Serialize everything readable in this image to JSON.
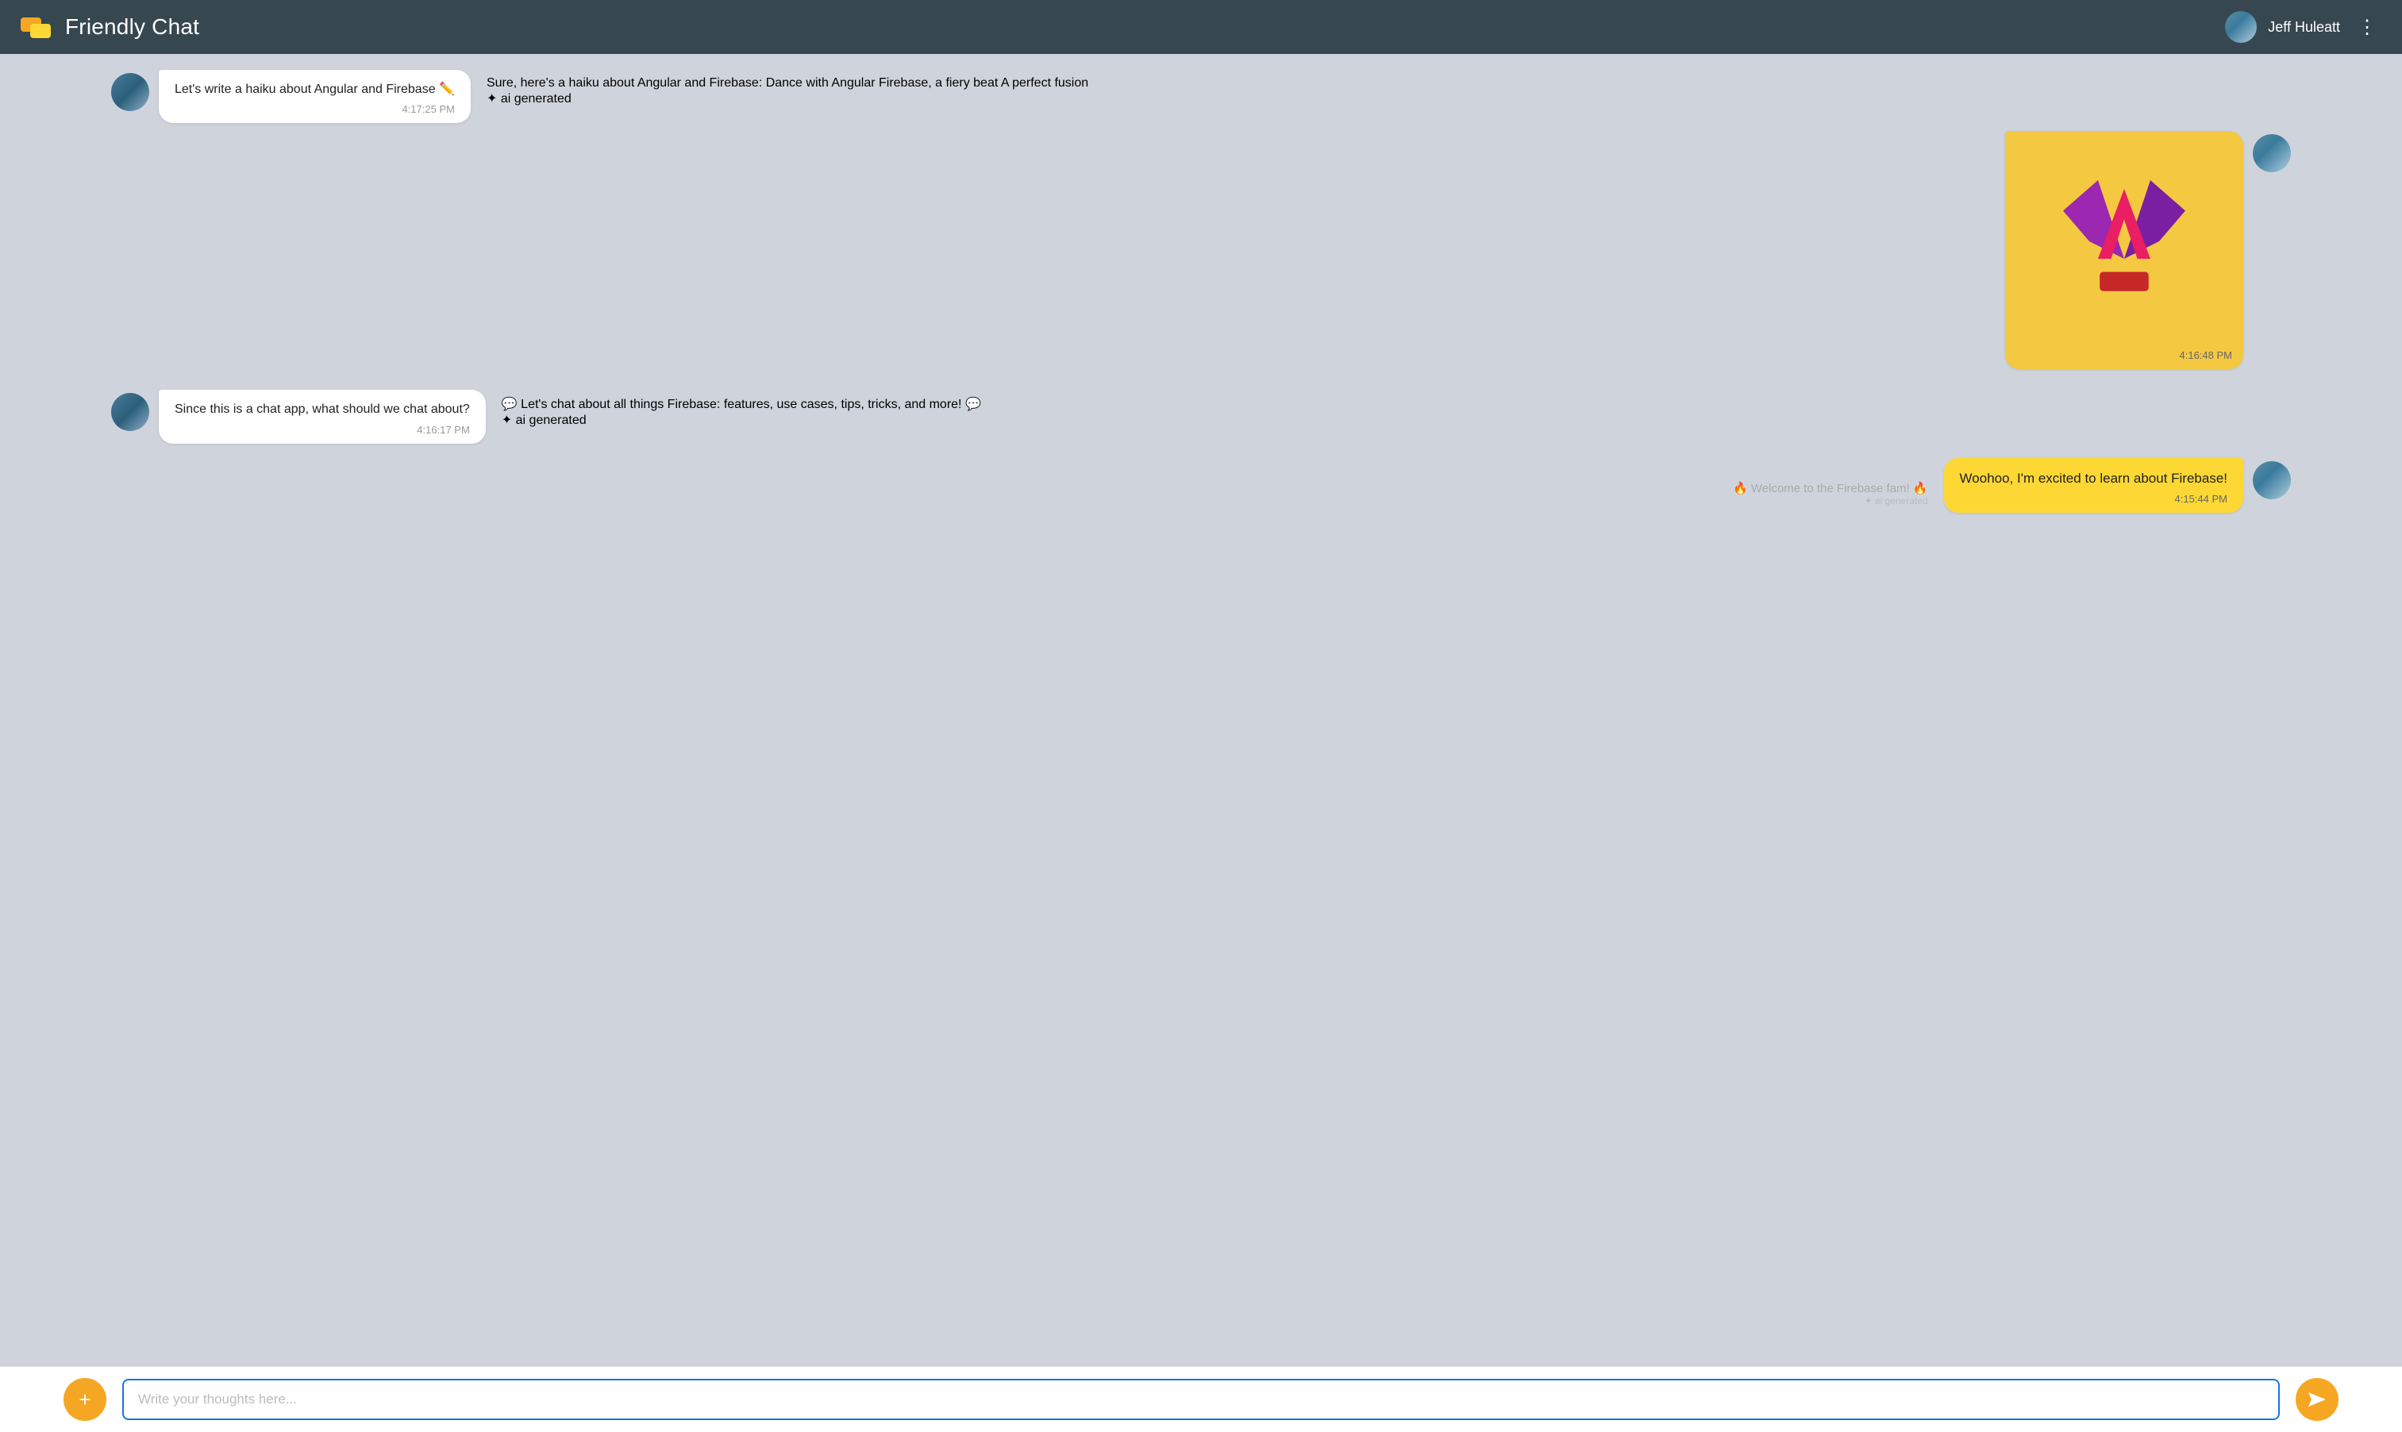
{
  "header": {
    "title": "Friendly Chat",
    "user_name": "Jeff Huleatt",
    "menu_label": "⋮"
  },
  "messages": [
    {
      "id": "msg1",
      "type": "incoming_with_ai",
      "sender_avatar": "user1",
      "text": "Let's write a haiku about Angular and Firebase ✏️",
      "time": "4:17:25 PM",
      "ai_text": "Sure, here's a haiku about Angular and Firebase: Dance with Angular Firebase, a fiery beat A perfect fusion",
      "ai_badge": "✦ ai generated"
    },
    {
      "id": "msg2",
      "type": "outgoing_image",
      "time": "4:16:48 PM"
    },
    {
      "id": "msg3",
      "type": "incoming_with_ai",
      "sender_avatar": "user1",
      "text": "Since this is a chat app, what should we chat about?",
      "time": "4:16:17 PM",
      "ai_text": "💬 Let's chat about all things Firebase: features, use cases, tips, tricks, and more! 💬",
      "ai_badge": "✦ ai generated"
    },
    {
      "id": "msg4",
      "type": "outgoing_with_ai",
      "sender_avatar": "user2",
      "text": "Woohoo, I'm excited to learn about Firebase!",
      "time": "4:15:44 PM",
      "ai_text": "🔥 Welcome to the Firebase fam! 🔥",
      "ai_badge": "✦ ai generated"
    }
  ],
  "footer": {
    "input_placeholder": "Write your thoughts here...",
    "add_label": "+",
    "send_label": "➢"
  }
}
